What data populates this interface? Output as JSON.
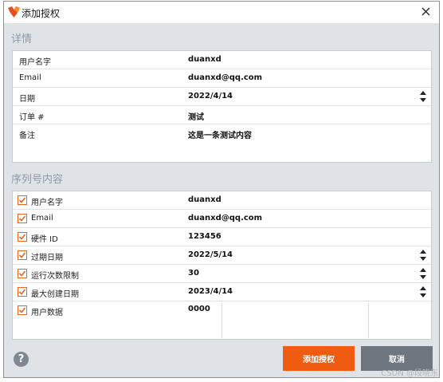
{
  "window": {
    "title": "添加授权",
    "close_icon": "close-icon",
    "app_icon": "logo-icon"
  },
  "details": {
    "title": "详情",
    "rows": [
      {
        "label": "用户名字",
        "value": "duanxd"
      },
      {
        "label": "Email",
        "value": "duanxd@qq.com"
      },
      {
        "label": "日期",
        "value": "2022/4/14"
      },
      {
        "label": "订单 #",
        "value": "测试"
      },
      {
        "label": "备注",
        "value": "这是一条测试内容"
      }
    ]
  },
  "serial": {
    "title": "序列号内容",
    "rows": [
      {
        "label": "用户名字",
        "value": "duanxd",
        "checked": true
      },
      {
        "label": "Email",
        "value": "duanxd@qq.com",
        "checked": true
      },
      {
        "label": "硬件 ID",
        "value": "123456",
        "checked": true
      },
      {
        "label": "过期日期",
        "value": "2022/5/14",
        "checked": true
      },
      {
        "label": "运行次数限制",
        "value": "30",
        "checked": true
      },
      {
        "label": "最大创建日期",
        "value": "2023/4/14",
        "checked": true
      },
      {
        "label": "用户数据",
        "value": "0000",
        "checked": true
      }
    ]
  },
  "footer": {
    "help_icon": "help-icon",
    "help_glyph": "?",
    "add_button": "添加授权",
    "cancel_button": "取消"
  },
  "watermark": "CSDN @段晓东",
  "colors": {
    "accent": "#ee5b11",
    "cancel": "#6e767f",
    "background": "#dfe3e8",
    "section_title": "#8e9aa6"
  }
}
